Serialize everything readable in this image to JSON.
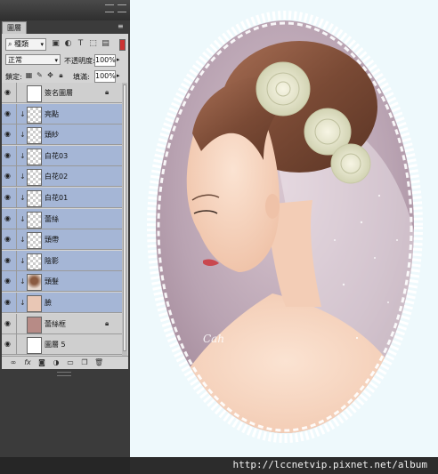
{
  "panel": {
    "tab_label": "圖層",
    "filter_kind": "種類",
    "blend_mode": "正常",
    "opacity_label": "不透明度:",
    "opacity_value": "100%",
    "lock_label": "鎖定:",
    "fill_label": "填滿:",
    "fill_value": "100%",
    "icons": {
      "visibility": "eye-icon",
      "clipping": "clip-arrow-icon",
      "lock": "lock-icon",
      "link": "link-icon",
      "fx": "fx-icon",
      "mask": "mask-icon",
      "adjustment": "adjustment-icon",
      "group": "folder-icon",
      "new_layer": "new-layer-icon",
      "delete": "trash-icon"
    },
    "fx_label": "fx",
    "layers": [
      {
        "name": "簽名圖層",
        "selected": false,
        "clipped": false,
        "locked": true,
        "thumb": "sig"
      },
      {
        "name": "亮點",
        "selected": true,
        "clipped": true,
        "locked": false,
        "thumb": "transparent"
      },
      {
        "name": "頭紗",
        "selected": true,
        "clipped": true,
        "locked": false,
        "thumb": "transparent"
      },
      {
        "name": "白花03",
        "selected": true,
        "clipped": true,
        "locked": false,
        "thumb": "transparent"
      },
      {
        "name": "白花02",
        "selected": true,
        "clipped": true,
        "locked": false,
        "thumb": "transparent"
      },
      {
        "name": "白花01",
        "selected": true,
        "clipped": true,
        "locked": false,
        "thumb": "transparent"
      },
      {
        "name": "蕾絲",
        "selected": true,
        "clipped": true,
        "locked": false,
        "thumb": "transparent"
      },
      {
        "name": "頭帶",
        "selected": true,
        "clipped": true,
        "locked": false,
        "thumb": "transparent"
      },
      {
        "name": "陰影",
        "selected": true,
        "clipped": true,
        "locked": false,
        "thumb": "transparent"
      },
      {
        "name": "頭髮",
        "selected": true,
        "clipped": true,
        "locked": false,
        "thumb": "hair"
      },
      {
        "name": "臉",
        "selected": true,
        "clipped": true,
        "locked": false,
        "thumb": "face"
      },
      {
        "name": "蕾絲框",
        "selected": false,
        "clipped": false,
        "locked": true,
        "thumb": "lace"
      },
      {
        "name": "圖層 5",
        "selected": false,
        "clipped": false,
        "locked": false,
        "thumb": "white"
      }
    ]
  },
  "canvas": {
    "background_color": "#eef9fc",
    "oval_color": "#bba6b4",
    "lace_color": "#ffffff",
    "artwork_description_icon": "bride-illustration-artwork",
    "signature_text": "Cah"
  },
  "footer": {
    "url": "http://lccnetvip.pixnet.net/album"
  }
}
